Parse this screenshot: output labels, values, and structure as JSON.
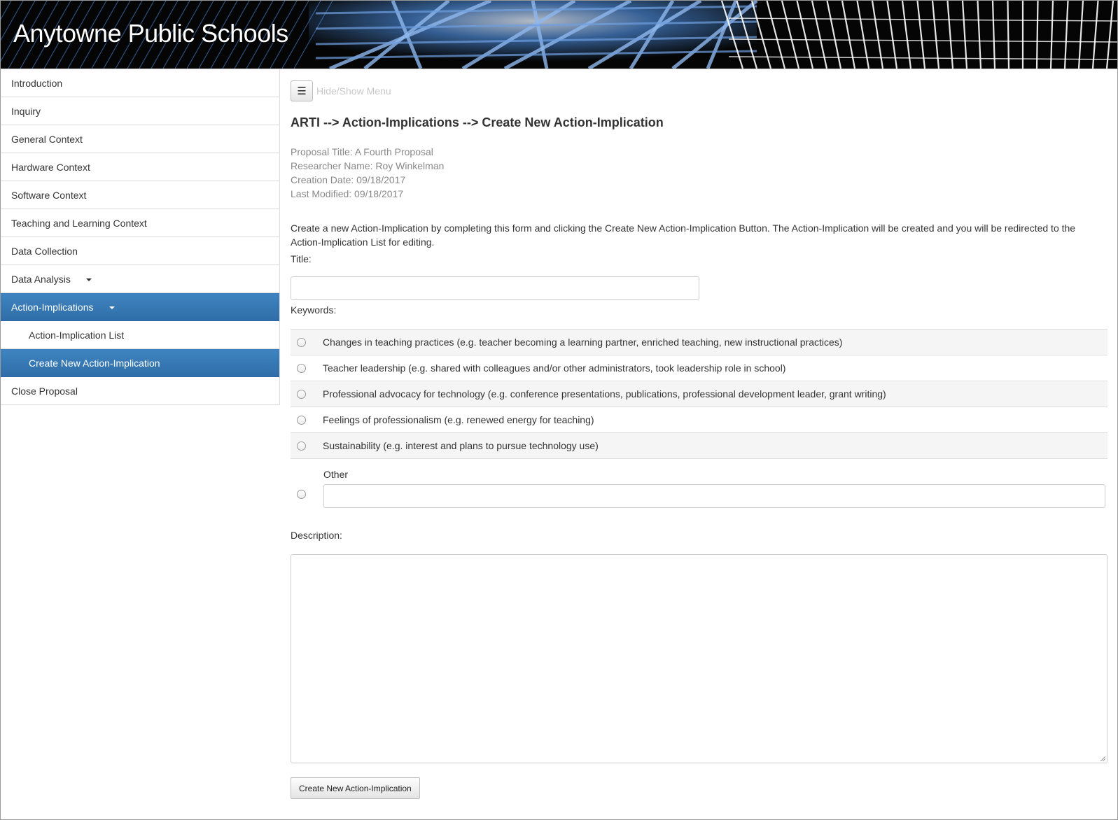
{
  "header": {
    "site_title": "Anytowne Public Schools"
  },
  "sidebar": {
    "items": [
      {
        "label": "Introduction"
      },
      {
        "label": "Inquiry"
      },
      {
        "label": "General Context"
      },
      {
        "label": "Hardware Context"
      },
      {
        "label": "Software Context"
      },
      {
        "label": "Teaching and Learning Context"
      },
      {
        "label": "Data Collection"
      },
      {
        "label": "Data Analysis"
      },
      {
        "label": "Action-Implications"
      },
      {
        "label": "Action-Implication List"
      },
      {
        "label": "Create New Action-Implication"
      },
      {
        "label": "Close Proposal"
      }
    ]
  },
  "toolbar": {
    "menu_icon": "☰",
    "toggle_label": "Hide/Show Menu"
  },
  "page": {
    "heading": "ARTI --> Action-Implications --> Create New Action-Implication",
    "proposal_title": "Proposal Title: A Fourth Proposal",
    "researcher_name": "Researcher Name: Roy Winkelman",
    "creation_date": "Creation Date: 09/18/2017",
    "last_modified": "Last Modified: 09/18/2017",
    "intro": "Create a new Action-Implication by completing this form and clicking the Create New Action-Implication Button. The Action-Implication will be created and you will be redirected to the Action-Implication List for editing."
  },
  "form": {
    "title_label": "Title:",
    "title_value": "",
    "keywords_label": "Keywords:",
    "keywords": [
      {
        "label": "Changes in teaching practices (e.g. teacher becoming a learning partner, enriched teaching, new instructional practices)"
      },
      {
        "label": "Teacher leadership (e.g. shared with colleagues and/or other administrators, took leadership role in school)"
      },
      {
        "label": "Professional advocacy for technology (e.g. conference presentations, publications, professional development leader, grant writing)"
      },
      {
        "label": "Feelings of professionalism (e.g. renewed energy for teaching)"
      },
      {
        "label": "Sustainability (e.g. interest and plans to pursue technology use)"
      }
    ],
    "other_label": "Other",
    "other_value": "",
    "description_label": "Description:",
    "description_value": "",
    "submit_label": "Create New Action-Implication"
  },
  "colors": {
    "active_nav": "#3a7bb8",
    "banner_accent": "#4f8fe0"
  }
}
